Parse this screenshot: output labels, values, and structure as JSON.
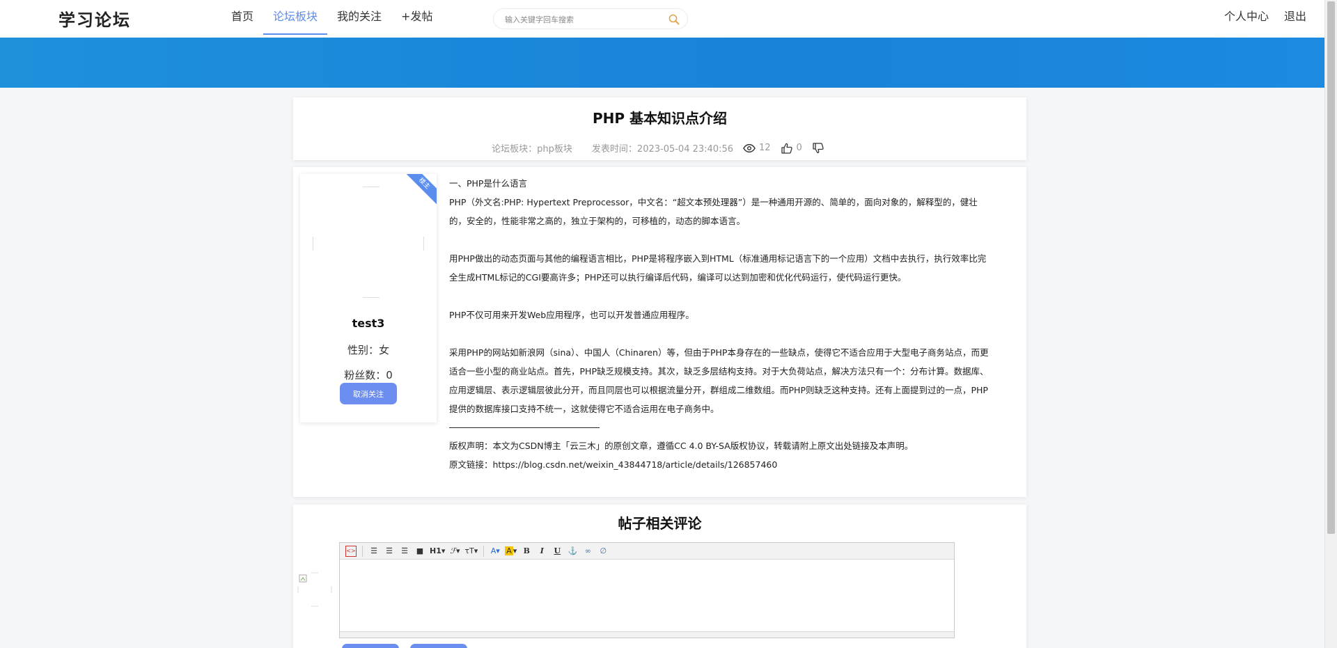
{
  "header": {
    "logo": "学习论坛",
    "nav": [
      "首页",
      "论坛板块",
      "我的关注",
      "+发帖"
    ],
    "active_nav": 1,
    "search_placeholder": "输入关键字回车搜索",
    "user_center": "个人中心",
    "logout": "退出"
  },
  "post": {
    "title": "PHP 基本知识点介绍",
    "board_label": "论坛板块：php板块",
    "time_label": "发表时间：2023-05-04 23:40:56",
    "views": "12",
    "likes": "0"
  },
  "author": {
    "ribbon": "楼主",
    "name": "test3",
    "gender_line": "性别：女",
    "fans_line": "粉丝数：0",
    "unfollow": "取消关注"
  },
  "article": {
    "p1": "一、PHP是什么语言",
    "p2": "PHP（外文名:PHP: Hypertext Preprocessor，中文名：“超文本预处理器”）是一种通用开源的、简单的，面向对象的，解释型的，健壮的，安全的，性能非常之高的，独立于架构的，可移植的，动态的脚本语言。",
    "p3": "用PHP做出的动态页面与其他的编程语言相比，PHP是将程序嵌入到HTML（标准通用标记语言下的一个应用）文档中去执行，执行效率比完全生成HTML标记的CGI要高许多；PHP还可以执行编译后代码，编译可以达到加密和优化代码运行，使代码运行更快。",
    "p4": "PHP不仅可用来开发Web应用程序，也可以开发普通应用程序。",
    "p5": "采用PHP的网站如新浪网（sina）、中国人（Chinaren）等，但由于PHP本身存在的一些缺点，使得它不适合应用于大型电子商务站点，而更适合一些小型的商业站点。首先，PHP缺乏规模支持。其次，缺乏多层结构支持。对于大负荷站点，解决方法只有一个：分布计算。数据库、应用逻辑层、表示逻辑层彼此分开，而且同层也可以根据流量分开，群组成二维数组。而PHP则缺乏这种支持。还有上面提到过的一点，PHP提供的数据库接口支持不统一，这就使得它不适合运用在电子商务中。",
    "copyright": "版权声明：本文为CSDN博主「云三木」的原创文章，遵循CC 4.0 BY-SA版权协议，转载请附上原文出处链接及本声明。",
    "source": "原文链接：https://blog.csdn.net/weixin_43844718/article/details/126857460"
  },
  "comments": {
    "title": "帖子相关评论"
  },
  "colors": {
    "accent": "#5b8def",
    "banner": "#1883d8",
    "button": "#6b8ef0"
  }
}
